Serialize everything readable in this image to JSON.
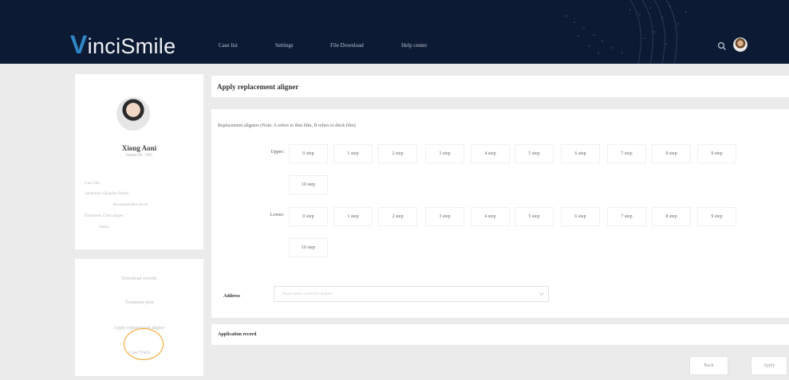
{
  "header": {
    "logo_initial": "V",
    "logo_rest": "inciSmile",
    "nav": [
      "Case list",
      "Settings",
      "File Download",
      "Help center"
    ],
    "search_icon": "search-icon",
    "avatar_icon": "user-avatar"
  },
  "patient": {
    "name": "Xiong Aoni",
    "sub": "Patient ID: 7305",
    "info": [
      "Case title:",
      "Institution: Qingdao Dental",
      "Recommended doctor",
      "Treatment: Clear aligner",
      "Status:"
    ]
  },
  "menu": [
    "Download records",
    "Treatment plan",
    "Apply replacement aligner",
    "Case Track"
  ],
  "main": {
    "title": "Apply replacement aligner",
    "note": "Replacement aligners (Note: A refers to thin film, B refers to thick film)",
    "upper_label": "Upper:",
    "lower_label": "Lower:",
    "upper_steps": [
      "0 step",
      "1 step",
      "2 step",
      "3 step",
      "4 step",
      "5 step",
      "6 step",
      "7 step",
      "8 step",
      "9 step",
      "10 step"
    ],
    "lower_steps": [
      "0 step",
      "1 step",
      "2 step",
      "3 step",
      "4 step",
      "5 step",
      "6 step",
      "7 step",
      "8 step",
      "9 step",
      "10 step"
    ],
    "address_label": "Address",
    "address_placeholder": "Please select a delivery address",
    "record_title": "Application record"
  },
  "buttons": {
    "back": "Back",
    "apply": "Apply"
  }
}
